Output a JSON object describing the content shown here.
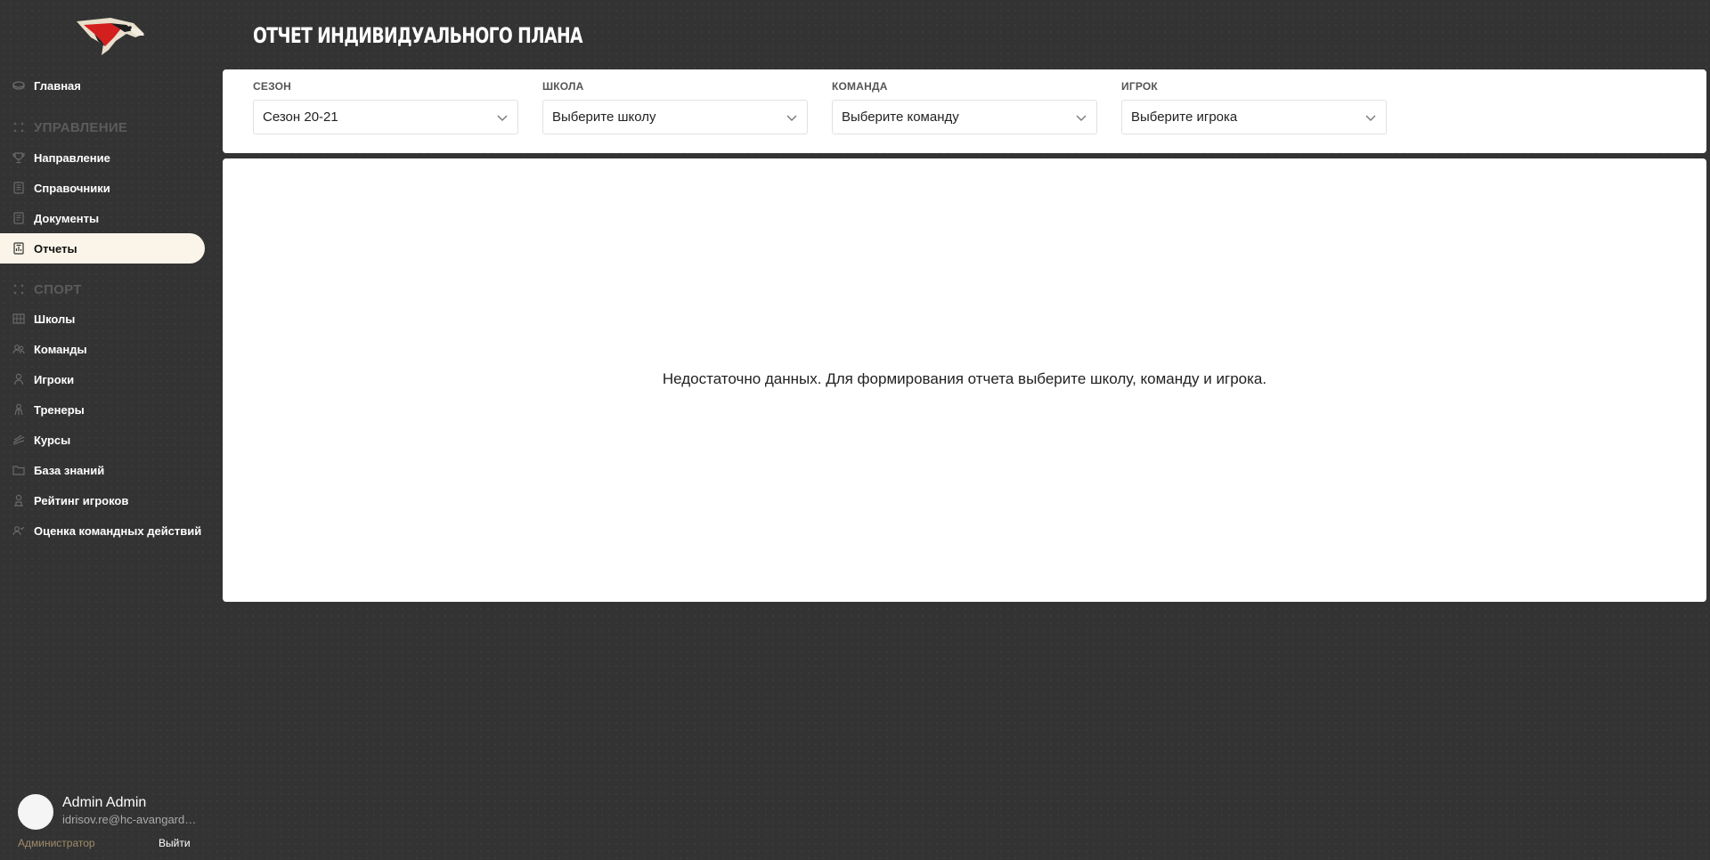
{
  "app": {
    "title": "ОТЧЕТ ИНДИВИДУАЛЬНОГО ПЛАНА",
    "logo": "hawk-logo"
  },
  "sidebar": {
    "home": {
      "label": "Главная",
      "icon": "puck-icon"
    },
    "sections": [
      {
        "header": "УПРАВЛЕНИЕ",
        "icon": "dots-grid-icon",
        "items": [
          {
            "label": "Направление",
            "icon": "trophy-icon"
          },
          {
            "label": "Справочники",
            "icon": "book-icon"
          },
          {
            "label": "Документы",
            "icon": "document-icon"
          },
          {
            "label": "Отчеты",
            "icon": "report-icon",
            "active": true
          }
        ]
      },
      {
        "header": "СПОРТ",
        "icon": "dots-grid-icon",
        "items": [
          {
            "label": "Школы",
            "icon": "school-icon"
          },
          {
            "label": "Команды",
            "icon": "team-icon"
          },
          {
            "label": "Игроки",
            "icon": "player-icon"
          },
          {
            "label": "Тренеры",
            "icon": "coach-icon"
          },
          {
            "label": "Курсы",
            "icon": "courses-icon"
          },
          {
            "label": "База знаний",
            "icon": "folder-icon"
          },
          {
            "label": "Рейтинг игроков",
            "icon": "rating-icon"
          },
          {
            "label": "Оценка командных действий",
            "icon": "team-eval-icon"
          }
        ]
      }
    ]
  },
  "user": {
    "name": "Admin Admin",
    "email": "idrisov.re@hc-avangard.com",
    "role": "Администратор",
    "logout_label": "Выйти"
  },
  "filters": [
    {
      "label": "СЕЗОН",
      "value": "Сезон 20-21"
    },
    {
      "label": "ШКОЛА",
      "value": "Выберите школу"
    },
    {
      "label": "КОМАНДА",
      "value": "Выберите команду"
    },
    {
      "label": "ИГРОК",
      "value": "Выберите игрока"
    }
  ],
  "report": {
    "empty_message": "Недостаточно данных. Для формирования отчета выберите школу, команду и игрока."
  },
  "colors": {
    "background": "#333333",
    "active_item_bg": "#fbf5e9",
    "card_bg": "#ffffff",
    "role_color": "#a08c6a",
    "logo_red": "#e02020"
  }
}
